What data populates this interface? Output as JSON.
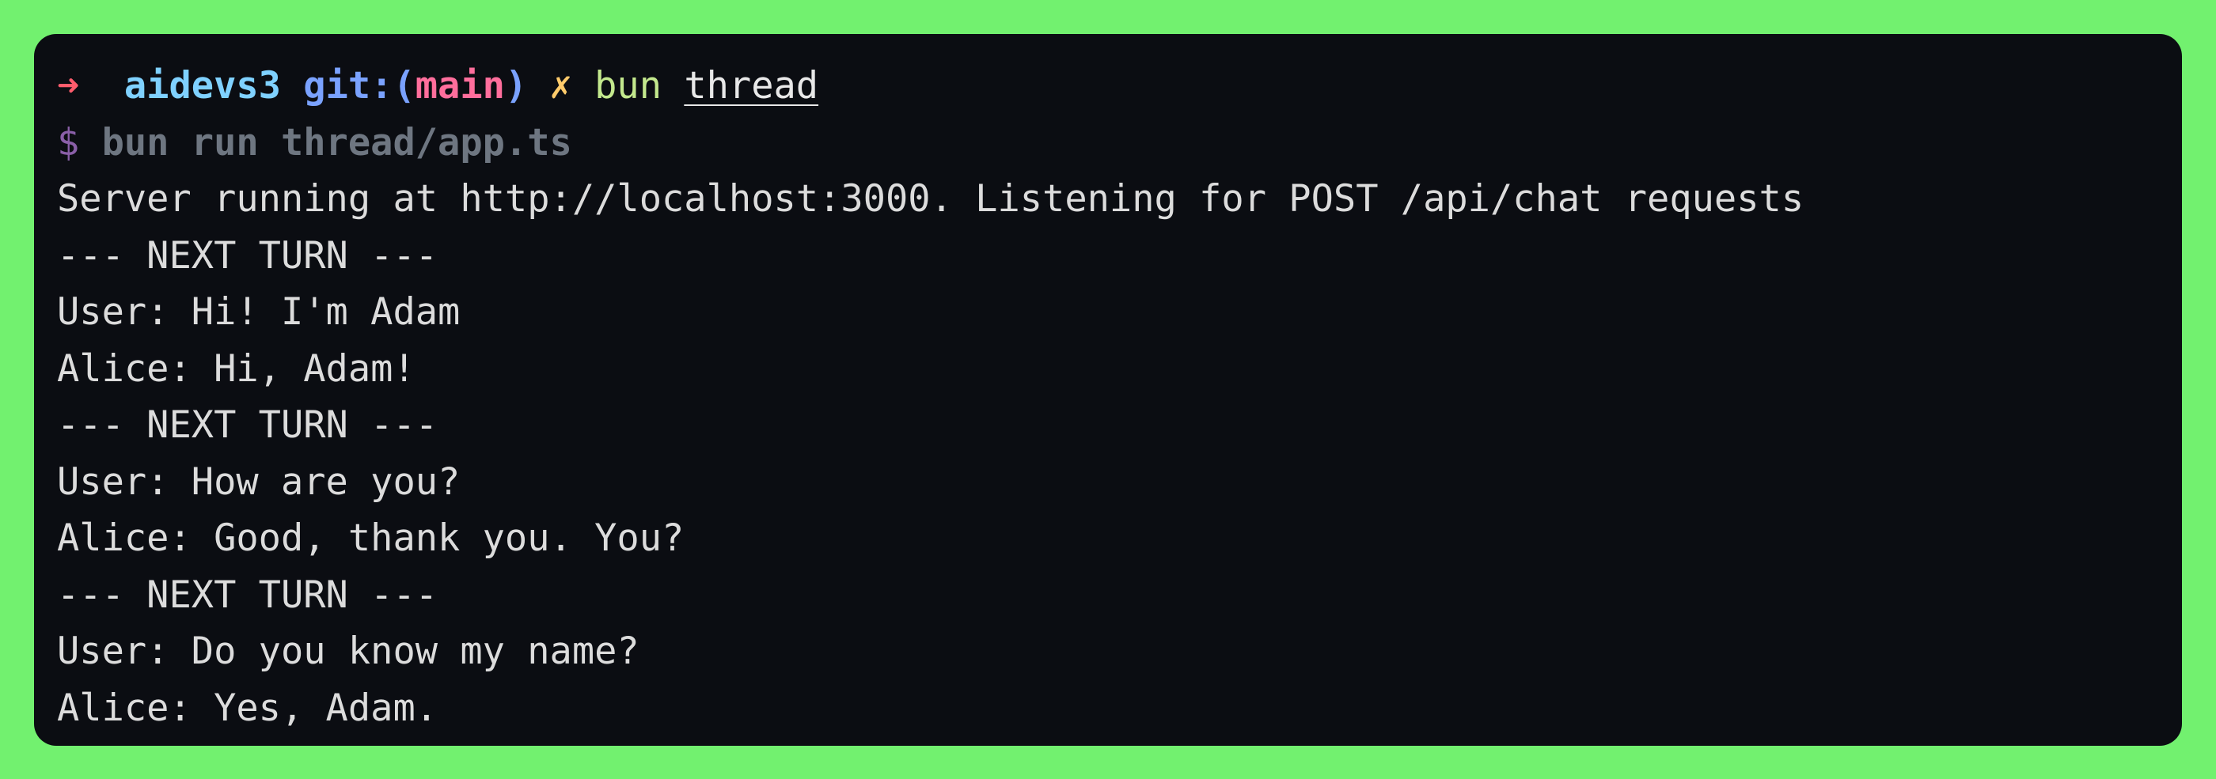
{
  "prompt": {
    "arrow": "➜",
    "repo": "aidevs3",
    "git_label": "git:(",
    "branch": "main",
    "git_close": ")",
    "dirty_mark": "✗",
    "command": "bun",
    "argument": "thread"
  },
  "run_line": {
    "sign": "$",
    "command": "bun run thread/app.ts"
  },
  "output": [
    "Server running at http://localhost:3000. Listening for POST /api/chat requests",
    "--- NEXT TURN ---",
    "User: Hi! I'm Adam",
    "Alice: Hi, Adam!",
    "--- NEXT TURN ---",
    "User: How are you?",
    "Alice: Good, thank you. You?",
    "--- NEXT TURN ---",
    "User: Do you know my name?",
    "Alice: Yes, Adam."
  ],
  "colors": {
    "background": "#72f16f",
    "terminal": "#0b0d12",
    "text": "#dcdcdc",
    "cursor": "#ffc861"
  }
}
